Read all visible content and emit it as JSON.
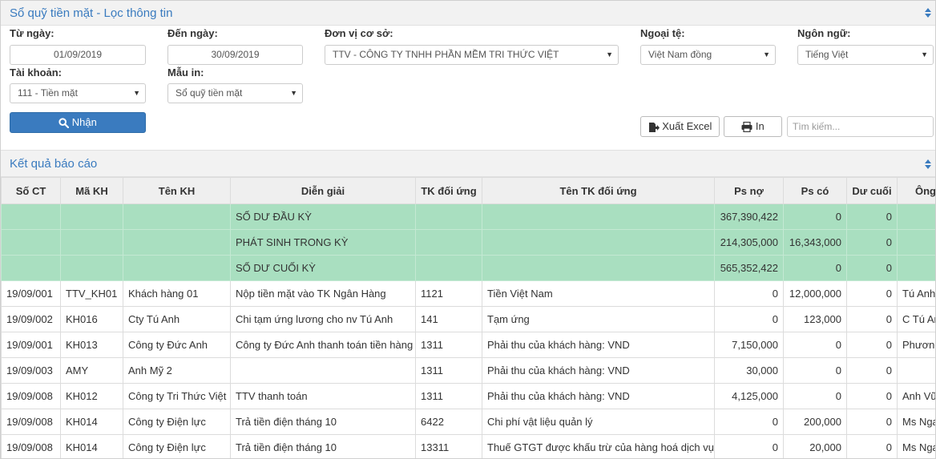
{
  "header": {
    "title": "Sổ quỹ tiền mặt - Lọc thông tin"
  },
  "filters": {
    "from_date": {
      "label": "Từ ngày:",
      "value": "01/09/2019"
    },
    "to_date": {
      "label": "Đến ngày:",
      "value": "30/09/2019"
    },
    "unit": {
      "label": "Đơn vị cơ sở:",
      "value": "TTV - CÔNG TY TNHH PHẦN MỀM TRI THỨC VIỆT"
    },
    "currency": {
      "label": "Ngoại tệ:",
      "value": "Việt Nam đồng"
    },
    "language": {
      "label": "Ngôn ngữ:",
      "value": "Tiếng Việt"
    },
    "account": {
      "label": "Tài khoản:",
      "value": "111 - Tiền mặt"
    },
    "template": {
      "label": "Mẫu in:",
      "value": "Sổ quỹ tiền mặt"
    }
  },
  "actions": {
    "submit_label": "Nhận",
    "export_label": "Xuất Excel",
    "print_label": "In",
    "search_placeholder": "Tìm kiếm..."
  },
  "results": {
    "title": "Kết quả báo cáo",
    "columns": [
      "Số CT",
      "Mã KH",
      "Tên KH",
      "Diễn giải",
      "TK đối ứng",
      "Tên TK đối ứng",
      "Ps nợ",
      "Ps có",
      "Dư cuối",
      "Ông"
    ],
    "summary_rows": [
      {
        "desc": "SỐ DƯ ĐẦU KỲ",
        "debit": "367,390,422",
        "credit": "0",
        "balance": "0"
      },
      {
        "desc": "PHÁT SINH TRONG KỲ",
        "debit": "214,305,000",
        "credit": "16,343,000",
        "balance": "0"
      },
      {
        "desc": "SỐ DƯ CUỐI KỲ",
        "debit": "565,352,422",
        "credit": "0",
        "balance": "0"
      }
    ],
    "rows": [
      {
        "so_ct": "19/09/001",
        "ma_kh": "TTV_KH01",
        "ten_kh": "Khách hàng 01",
        "dien_giai": "Nộp tiền mặt vào TK Ngân Hàng",
        "tk": "1121",
        "ten_tk": "Tiền Việt Nam",
        "no": "0",
        "co": "12,000,000",
        "du": "0",
        "ong": "Tú Anh"
      },
      {
        "so_ct": "19/09/002",
        "ma_kh": "KH016",
        "ten_kh": "Cty Tú Anh",
        "dien_giai": "Chi tạm ứng lương cho nv Tú Anh",
        "tk": "141",
        "ten_tk": "Tạm ứng",
        "no": "0",
        "co": "123,000",
        "du": "0",
        "ong": "C Tú Anh"
      },
      {
        "so_ct": "19/09/001",
        "ma_kh": "KH013",
        "ten_kh": "Công ty Đức Anh",
        "dien_giai": "Công ty Đức Anh thanh toán tiền hàng",
        "tk": "1311",
        "ten_tk": "Phải thu của khách hàng: VND",
        "no": "7,150,000",
        "co": "0",
        "du": "0",
        "ong": "Phương"
      },
      {
        "so_ct": "19/09/003",
        "ma_kh": "AMY",
        "ten_kh": "Anh Mỹ 2",
        "dien_giai": "",
        "tk": "1311",
        "ten_tk": "Phải thu của khách hàng: VND",
        "no": "30,000",
        "co": "0",
        "du": "0",
        "ong": ""
      },
      {
        "so_ct": "19/09/008",
        "ma_kh": "KH012",
        "ten_kh": "Công ty Tri Thức Việt",
        "dien_giai": "TTV thanh toán",
        "tk": "1311",
        "ten_tk": "Phải thu của khách hàng: VND",
        "no": "4,125,000",
        "co": "0",
        "du": "0",
        "ong": "Anh Vũ"
      },
      {
        "so_ct": "19/09/008",
        "ma_kh": "KH014",
        "ten_kh": "Công ty Điện lực",
        "dien_giai": "Trả tiền điện tháng 10",
        "tk": "6422",
        "ten_tk": "Chi phí vật liệu quản lý",
        "no": "0",
        "co": "200,000",
        "du": "0",
        "ong": "Ms Nga"
      },
      {
        "so_ct": "19/09/008",
        "ma_kh": "KH014",
        "ten_kh": "Công ty Điện lực",
        "dien_giai": "Trả tiền điện tháng 10",
        "tk": "13311",
        "ten_tk": "Thuế GTGT được khấu trừ của hàng hoá dịch vụ",
        "no": "0",
        "co": "20,000",
        "du": "0",
        "ong": "Ms Nga"
      }
    ]
  },
  "colors": {
    "accent": "#3a7bbf",
    "summary_bg": "#a9dfc0",
    "header_bg": "#f2f2f2"
  }
}
